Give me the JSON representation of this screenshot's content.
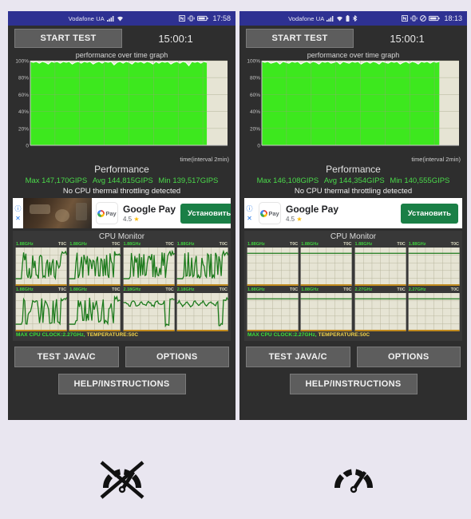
{
  "page": {
    "background_color": "#e9e6f0"
  },
  "phones": [
    {
      "id": "left",
      "status_bar": {
        "carrier": "Vodafone UA",
        "signal_icon": "signal-bars-icon",
        "wifi_icon": "wifi-icon",
        "nfc_icon": "nfc-icon",
        "vibrate_icon": "vibrate-icon",
        "battery_icon": "battery-icon",
        "clock": "17:58",
        "background_color": "#2e3192"
      },
      "toolbar": {
        "start_label": "START TEST",
        "timer": "15:00:1"
      },
      "graph": {
        "title": "performance over time graph",
        "x_label": "time(interval 2min)",
        "y_ticks": [
          "100%",
          "80%",
          "60%",
          "40%",
          "20%",
          "0"
        ],
        "fill_color": "#3de81e",
        "fill_fraction": 0.895
      },
      "performance": {
        "title": "Performance",
        "max_label": "Max 147,170GIPS",
        "avg_label": "Avg 144,815GIPS",
        "min_label": "Min 139,517GIPS",
        "throttle_note": "No CPU thermal throttling detected",
        "stats_color": "#4ad94a"
      },
      "ad": {
        "info_icon": "info-icon",
        "close_icon": "close-icon",
        "has_thumbnail": true,
        "brand_icon": "google-pay-icon",
        "brand_icon_label": "Pay",
        "title": "Google Pay",
        "rating": "4.5",
        "star_icon": "star-icon",
        "cta_label": "Установить",
        "cta_color": "#1a7f46"
      },
      "cpu_monitor": {
        "title": "CPU Monitor",
        "cores": [
          {
            "freq": "1.88GHz",
            "temp": "T0C"
          },
          {
            "freq": "1.88GHz",
            "temp": "T0C"
          },
          {
            "freq": "1.88GHz",
            "temp": "T0C"
          },
          {
            "freq": "1.88GHz",
            "temp": "T0C"
          },
          {
            "freq": "1.88GHz",
            "temp": "T0C"
          },
          {
            "freq": "1.88GHz",
            "temp": "T0C"
          },
          {
            "freq": "2.18GHz",
            "temp": "T0C"
          },
          {
            "freq": "2.18GHz",
            "temp": "T0C"
          }
        ],
        "footer_clock": "MAX CPU CLOCK:2.27GHz,",
        "footer_temp": "TEMPERATURE:50C"
      },
      "buttons": {
        "test_java": "TEST JAVA/C",
        "options": "OPTIONS",
        "help": "HELP/INSTRUCTIONS"
      },
      "verdict_icon": "no-throttle-gauge-icon"
    },
    {
      "id": "right",
      "status_bar": {
        "carrier": "Vodafone UA",
        "signal_icon": "signal-bars-icon",
        "wifi_icon": "wifi-icon",
        "battery_small_icon": "battery-small-icon",
        "bluetooth_icon": "bluetooth-icon",
        "nfc_icon": "nfc-icon",
        "vibrate_icon": "vibrate-icon",
        "dnd_icon": "do-not-disturb-icon",
        "battery_icon": "battery-icon",
        "clock": "18:13",
        "background_color": "#2e3192"
      },
      "toolbar": {
        "start_label": "START TEST",
        "timer": "15:00:1"
      },
      "graph": {
        "title": "performance over time graph",
        "x_label": "time(interval 2min)",
        "y_ticks": [
          "100%",
          "80%",
          "60%",
          "40%",
          "20%",
          "0"
        ],
        "fill_color": "#3de81e",
        "fill_fraction": 0.9
      },
      "performance": {
        "title": "Performance",
        "max_label": "Max 146,108GIPS",
        "avg_label": "Avg 144,354GIPS",
        "min_label": "Min 140,555GIPS",
        "throttle_note": "No CPU thermal throttling detected",
        "stats_color": "#4ad94a"
      },
      "ad": {
        "info_icon": "info-icon",
        "close_icon": "close-icon",
        "has_thumbnail": false,
        "brand_icon": "google-pay-icon",
        "brand_icon_label": "Pay",
        "title": "Google Pay",
        "rating": "4.5",
        "star_icon": "star-icon",
        "cta_label": "Установить",
        "cta_color": "#1a7f46"
      },
      "cpu_monitor": {
        "title": "CPU Monitor",
        "cores": [
          {
            "freq": "1.88GHz",
            "temp": "T0C"
          },
          {
            "freq": "1.88GHz",
            "temp": "T0C"
          },
          {
            "freq": "1.88GHz",
            "temp": "T0C"
          },
          {
            "freq": "1.88GHz",
            "temp": "T0C"
          },
          {
            "freq": "1.88GHz",
            "temp": "T0C"
          },
          {
            "freq": "1.88GHz",
            "temp": "T0C"
          },
          {
            "freq": "2.27GHz",
            "temp": "T0C"
          },
          {
            "freq": "2.27GHz",
            "temp": "T0C"
          }
        ],
        "footer_clock": "MAX CPU CLOCK:2.27GHz,",
        "footer_temp": "TEMPERATURE:50C"
      },
      "buttons": {
        "test_java": "TEST JAVA/C",
        "options": "OPTIONS",
        "help": "HELP/INSTRUCTIONS"
      },
      "verdict_icon": "throttle-gauge-icon"
    }
  ],
  "chart_data": [
    {
      "type": "area",
      "id": "left-performance-over-time",
      "title": "performance over time graph",
      "xlabel": "time(interval 2min)",
      "ylabel": "",
      "ylim": [
        0,
        100
      ],
      "y_ticks": [
        0,
        20,
        40,
        60,
        80,
        100
      ],
      "grid": true,
      "series": [
        {
          "name": "performance %",
          "values": [
            99,
            98,
            99,
            97,
            99,
            98,
            96,
            99,
            98,
            99,
            97,
            99,
            98,
            99,
            96,
            98,
            99,
            97,
            99,
            98,
            99,
            96,
            98,
            99,
            97,
            99,
            98,
            99,
            95,
            98,
            99,
            97,
            99,
            98,
            96,
            99,
            98,
            99,
            97,
            99,
            98,
            96,
            99,
            97,
            99,
            98,
            99,
            96,
            98,
            99,
            97,
            99,
            98,
            94,
            99,
            98,
            99,
            97,
            99,
            98
          ]
        }
      ],
      "fill_color": "#3de81e",
      "max_gips": 147170,
      "avg_gips": 144815,
      "min_gips": 139517
    },
    {
      "type": "area",
      "id": "right-performance-over-time",
      "title": "performance over time graph",
      "xlabel": "time(interval 2min)",
      "ylabel": "",
      "ylim": [
        0,
        100
      ],
      "y_ticks": [
        0,
        20,
        40,
        60,
        80,
        100
      ],
      "grid": true,
      "series": [
        {
          "name": "performance %",
          "values": [
            99,
            98,
            99,
            97,
            98,
            99,
            96,
            99,
            98,
            97,
            99,
            98,
            99,
            96,
            98,
            99,
            97,
            99,
            98,
            96,
            99,
            98,
            99,
            97,
            98,
            99,
            96,
            99,
            98,
            97,
            99,
            98,
            99,
            96,
            98,
            99,
            97,
            99,
            98,
            96,
            99,
            98,
            97,
            99,
            98,
            99,
            96,
            98,
            99,
            97,
            99,
            98,
            96,
            99,
            98,
            99,
            97,
            99,
            98,
            99
          ]
        }
      ],
      "fill_color": "#3de81e",
      "max_gips": 146108,
      "avg_gips": 144354,
      "min_gips": 140555
    },
    {
      "type": "line",
      "id": "left-cpu-monitor",
      "title": "CPU Monitor",
      "note": "8 per-core frequency sparklines, active (fluctuating)",
      "core_freqs_ghz": [
        1.88,
        1.88,
        1.88,
        1.88,
        1.88,
        1.88,
        2.18,
        2.18
      ],
      "core_temps": [
        "T0C",
        "T0C",
        "T0C",
        "T0C",
        "T0C",
        "T0C",
        "T0C",
        "T0C"
      ],
      "max_cpu_clock_ghz": 2.27,
      "temperature_c": 50
    },
    {
      "type": "line",
      "id": "right-cpu-monitor",
      "title": "CPU Monitor",
      "note": "8 per-core frequency sparklines, mostly flat near top",
      "core_freqs_ghz": [
        1.88,
        1.88,
        1.88,
        1.88,
        1.88,
        1.88,
        2.27,
        2.27
      ],
      "core_temps": [
        "T0C",
        "T0C",
        "T0C",
        "T0C",
        "T0C",
        "T0C",
        "T0C",
        "T0C"
      ],
      "max_cpu_clock_ghz": 2.27,
      "temperature_c": 50
    }
  ]
}
